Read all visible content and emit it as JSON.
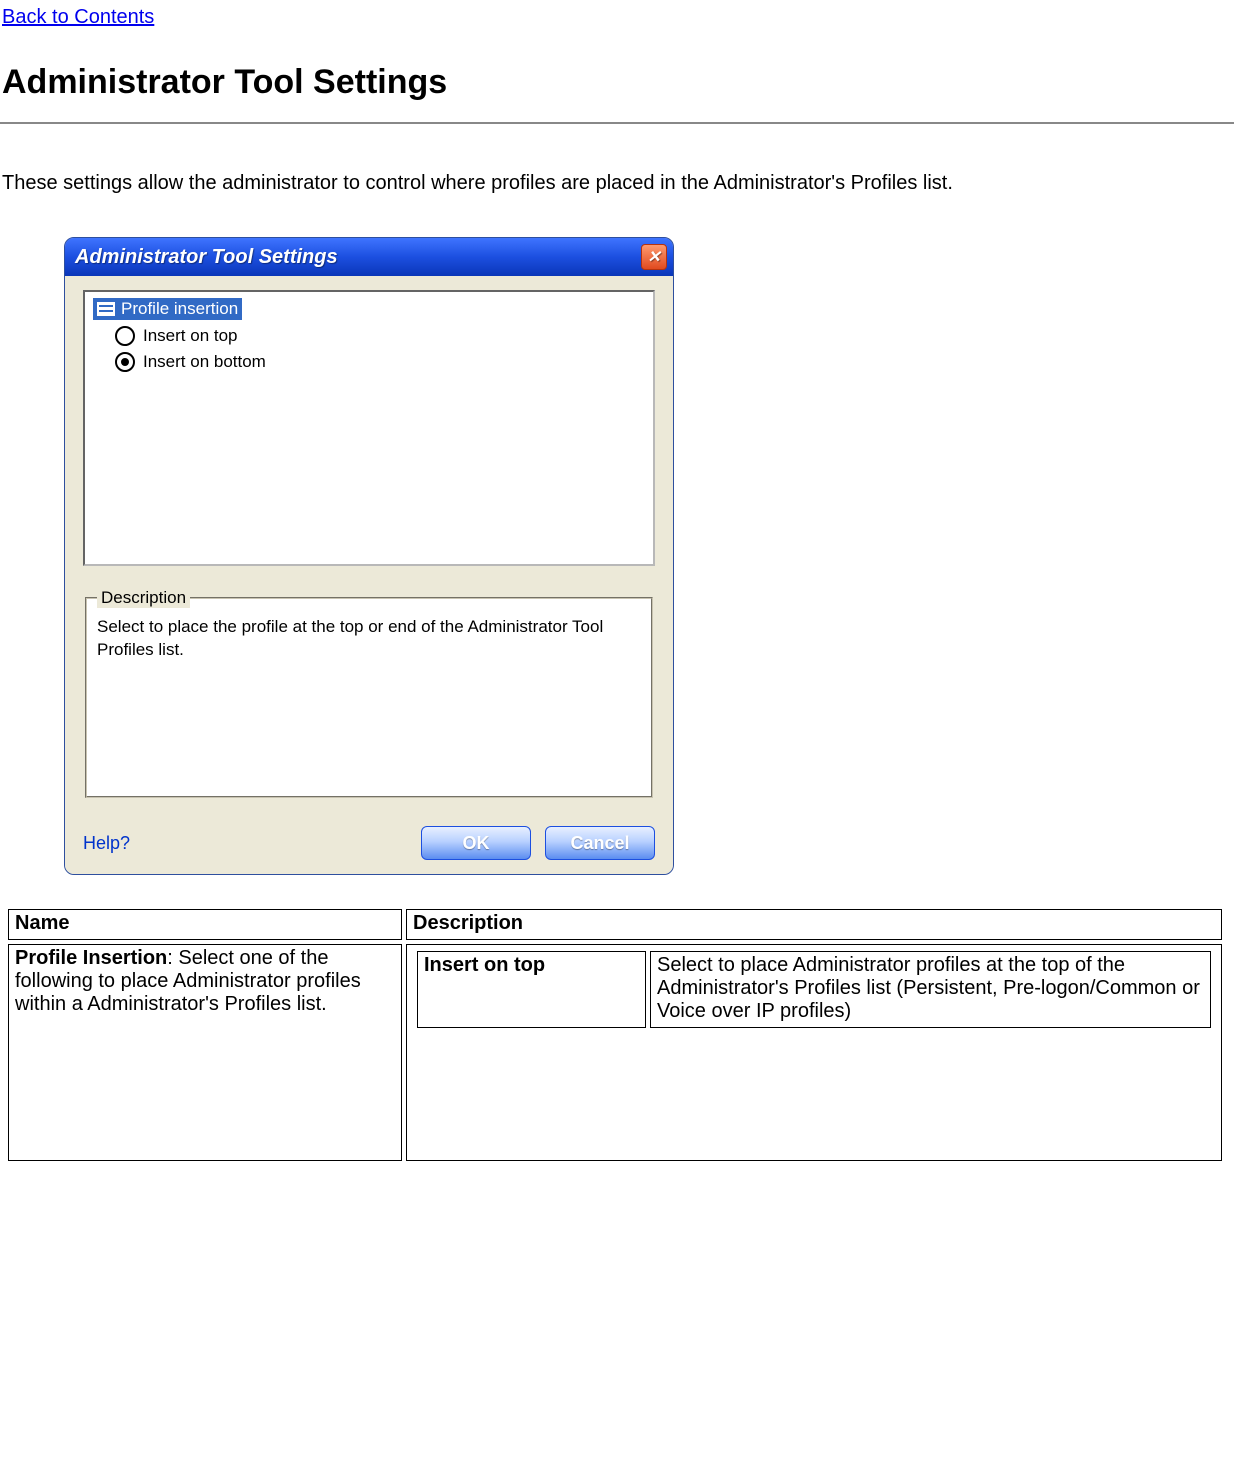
{
  "back_link": "Back to Contents",
  "page_title": "Administrator Tool Settings",
  "intro": "These settings allow the administrator to control where profiles are placed in the Administrator's Profiles list.",
  "dialog": {
    "title": "Administrator Tool Settings",
    "close_glyph": "✕",
    "tree_header": "Profile insertion",
    "option_top": "Insert on top",
    "option_bottom": "Insert on bottom",
    "fieldset_legend": "Description",
    "fieldset_text": "Select to place the profile at the top or end of the Administrator Tool Profiles list.",
    "help_label": "Help?",
    "ok_label": "OK",
    "cancel_label": "Cancel"
  },
  "table": {
    "th_name": "Name",
    "th_desc": "Description",
    "row1_name_bold": "Profile Insertion",
    "row1_name_rest": ": Select one of the following to place Administrator profiles within a Administrator's Profiles list.",
    "inner_r1_c1": "Insert on top",
    "inner_r1_c2": "Select to place Administrator profiles at the top of the Administrator's Profiles list (Persistent, Pre-logon/Common or Voice over IP profiles)"
  }
}
